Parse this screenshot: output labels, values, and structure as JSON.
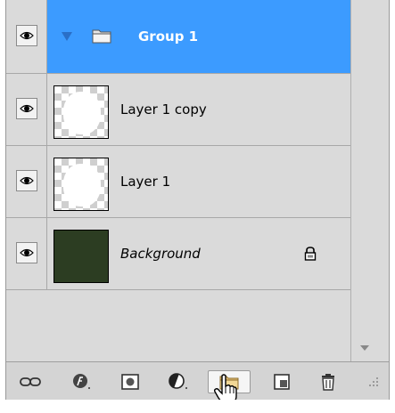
{
  "panel": {
    "name": "layers-panel"
  },
  "layers": [
    {
      "id": "group-1",
      "label": "Group 1",
      "type": "group",
      "visible": true,
      "selected": true,
      "expanded": true,
      "icon": "folder-icon"
    },
    {
      "id": "layer-1-copy",
      "label": "Layer 1 copy",
      "type": "layer",
      "visible": true,
      "thumbnail": "transparent-with-white-shape"
    },
    {
      "id": "layer-1",
      "label": "Layer 1",
      "type": "layer",
      "visible": true,
      "thumbnail": "transparent-with-white-shape"
    },
    {
      "id": "background",
      "label": "Background",
      "type": "background",
      "visible": true,
      "locked": true,
      "italic": true,
      "thumbnail": "solid-dark-green"
    }
  ],
  "toolbar": {
    "buttons": [
      {
        "name": "link-layers-button",
        "icon": "link-icon"
      },
      {
        "name": "add-layer-style-button",
        "icon": "fx-icon"
      },
      {
        "name": "add-mask-button",
        "icon": "mask-icon"
      },
      {
        "name": "new-adjustment-layer-button",
        "icon": "adjustment-icon"
      },
      {
        "name": "new-group-button",
        "icon": "folder-icon",
        "active": true
      },
      {
        "name": "new-layer-button",
        "icon": "new-layer-icon"
      },
      {
        "name": "delete-layer-button",
        "icon": "trash-icon"
      }
    ]
  },
  "colors": {
    "selected_row": "#3c9bff",
    "panel_bg": "#dadada",
    "background_layer_fill": "#2c3d22"
  }
}
